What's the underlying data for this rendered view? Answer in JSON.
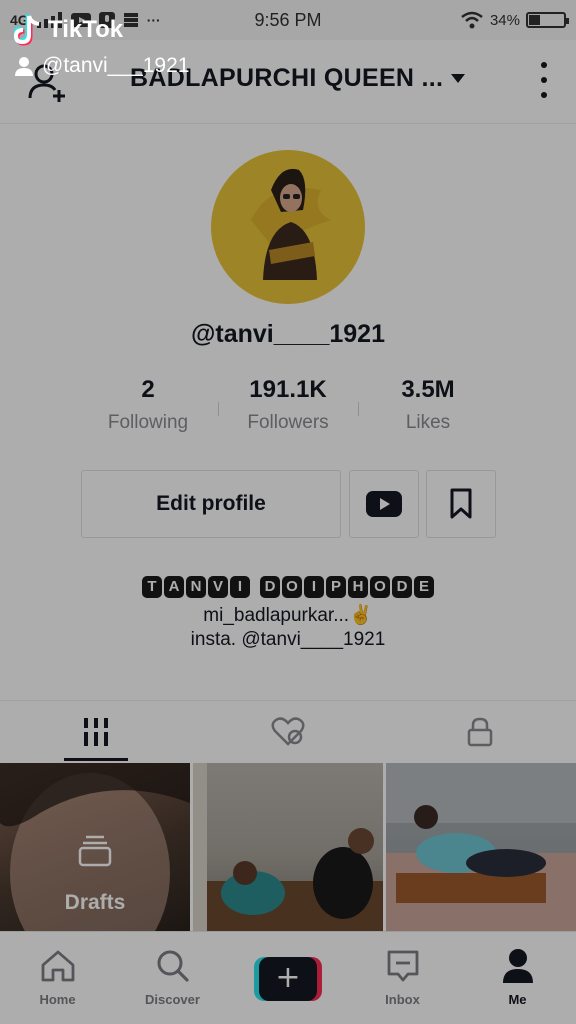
{
  "status_bar": {
    "network": "4G",
    "time": "9:56 PM",
    "battery": "34%"
  },
  "header": {
    "title": "BADLAPURCHI QUEEN ..."
  },
  "profile": {
    "username": "@tanvi____1921",
    "stats": [
      {
        "value": "2",
        "label": "Following"
      },
      {
        "value": "191.1K",
        "label": "Followers"
      },
      {
        "value": "3.5M",
        "label": "Likes"
      }
    ],
    "edit_label": "Edit profile",
    "bio_name_letters": [
      "T",
      "A",
      "N",
      "V",
      "I",
      " ",
      "D",
      "O",
      "I",
      "P",
      "H",
      "O",
      "D",
      "E"
    ],
    "bio_line1": "mi_badlapurkar...✌",
    "bio_line2": "insta. @tanvi____1921"
  },
  "grid": {
    "drafts_label": "Drafts"
  },
  "nav": [
    {
      "label": "Home"
    },
    {
      "label": "Discover"
    },
    {
      "label": ""
    },
    {
      "label": "Inbox"
    },
    {
      "label": "Me"
    }
  ],
  "watermark": {
    "brand": "TikTok",
    "user": "@tanvi___1921"
  },
  "colors": {
    "accent_red": "#fe2c55",
    "accent_cyan": "#2ae6ec",
    "avatar_bg": "#e8c53a"
  }
}
